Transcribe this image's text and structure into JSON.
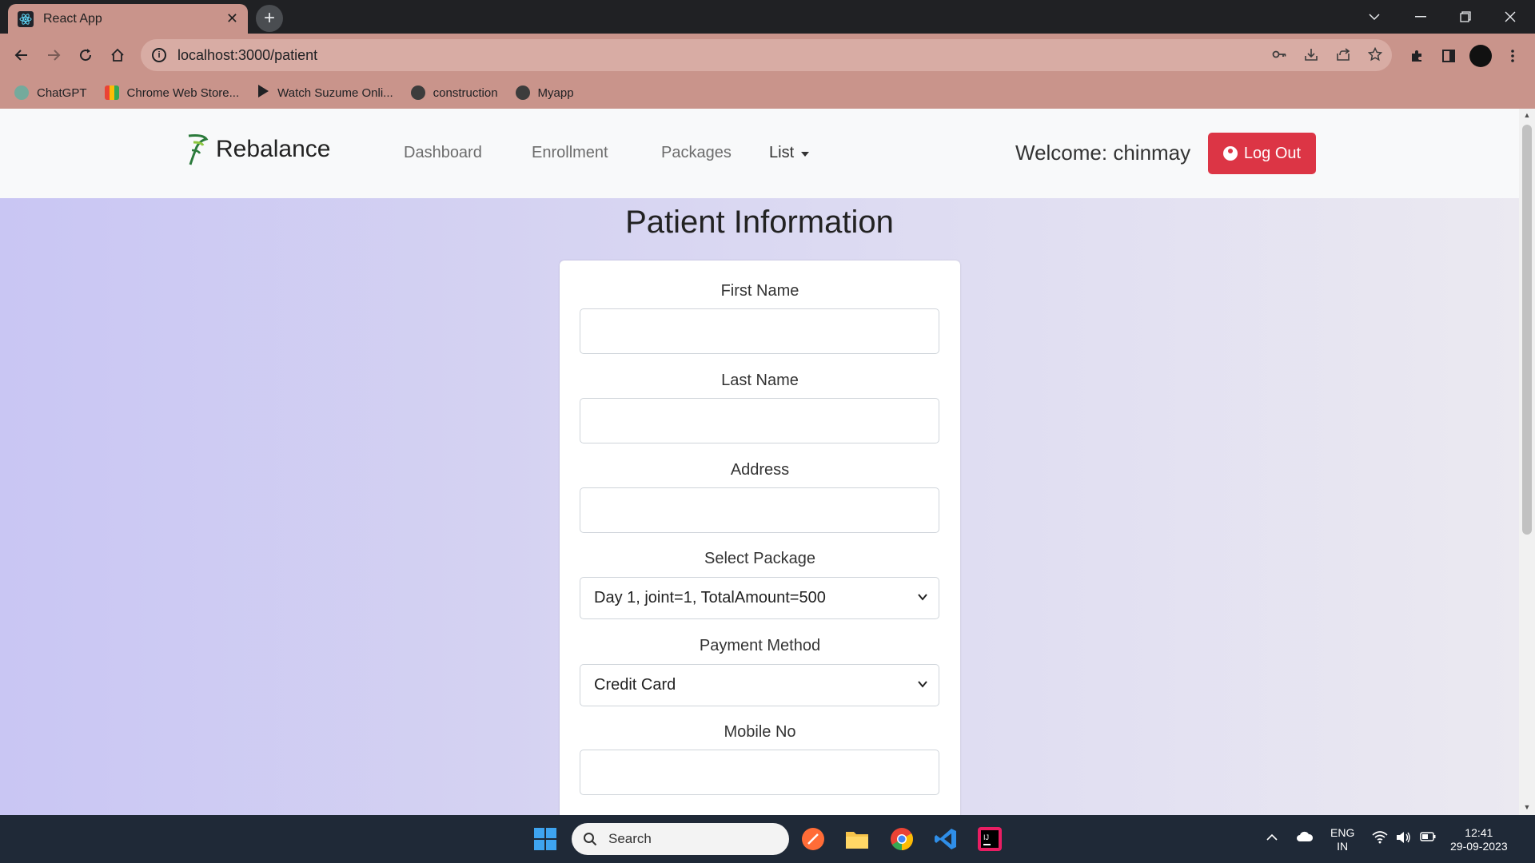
{
  "browser": {
    "tab_title": "React App",
    "tab_close": "✕",
    "new_tab": "+",
    "url": "localhost:3000/patient",
    "bookmarks": [
      {
        "label": "ChatGPT",
        "icon": "chatgpt-icon"
      },
      {
        "label": "Chrome Web Store...",
        "icon": "chrome-web-store-icon"
      },
      {
        "label": "Watch Suzume Onli...",
        "icon": "play-icon"
      },
      {
        "label": "construction",
        "icon": "globe-icon"
      },
      {
        "label": "Myapp",
        "icon": "globe-icon"
      }
    ]
  },
  "app": {
    "brand": "Rebalance",
    "nav": {
      "dashboard": "Dashboard",
      "enrollment": "Enrollment",
      "packages": "Packages",
      "list": "List"
    },
    "welcome": "Welcome: chinmay",
    "logout": "Log Out",
    "accent_color": "#dc3545"
  },
  "form": {
    "title": "Patient Information",
    "first_name_label": "First Name",
    "first_name_value": "",
    "last_name_label": "Last Name",
    "last_name_value": "",
    "address_label": "Address",
    "address_value": "",
    "package_label": "Select Package",
    "package_value": "Day 1, joint=1, TotalAmount=500",
    "payment_label": "Payment Method",
    "payment_value": "Credit Card",
    "mobile_label": "Mobile No",
    "mobile_value": ""
  },
  "taskbar": {
    "search_placeholder": "Search",
    "lang_line1": "ENG",
    "lang_line2": "IN",
    "time": "12:41",
    "date": "29-09-2023"
  }
}
